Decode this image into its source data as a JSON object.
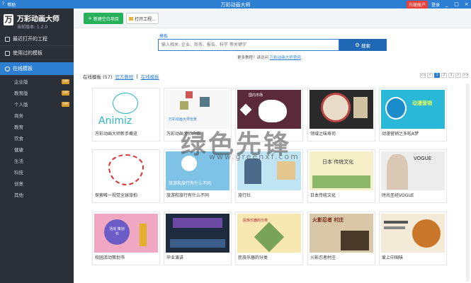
{
  "titlebar": {
    "menu": [
      "?",
      "帮助"
    ],
    "title": "万彩动画大师",
    "upgrade": "升级账户",
    "login": "登录",
    "controls": [
      "_",
      "□",
      "×"
    ]
  },
  "sidebar": {
    "logo_letter": "万",
    "app_name": "万彩动画大师",
    "version": "当前版本: 1.2.0",
    "nav": [
      {
        "label": "最近打开的工程",
        "icon": "folder-icon"
      },
      {
        "label": "使用过的模板",
        "icon": "template-icon"
      },
      {
        "label": "在线模板",
        "icon": "cloud-icon"
      }
    ],
    "categories": [
      {
        "label": "企业版",
        "vip": "VIP"
      },
      {
        "label": "教育版",
        "vip": "VIP"
      },
      {
        "label": "个人版",
        "vip": "VIP"
      },
      {
        "label": "商务"
      },
      {
        "label": "教育"
      },
      {
        "label": "饮食"
      },
      {
        "label": "健康"
      },
      {
        "label": "生活"
      },
      {
        "label": "科技"
      },
      {
        "label": "创意"
      },
      {
        "label": "其他"
      }
    ]
  },
  "toolbar": {
    "new_label": "新建空白项目",
    "open_label": "打开工程..."
  },
  "search": {
    "label": "模板",
    "placeholder": "输入相关: 企业、商务、报告、科学 等关键字",
    "button": "搜索",
    "more_text": "更多教程？请访问",
    "more_link": "万彩动画大师官网"
  },
  "section": {
    "title": "在线模板 (57)",
    "link1": "官方教程",
    "sep": "|",
    "link2": "在线模板"
  },
  "pager": [
    "<<",
    "<",
    "1",
    "2",
    "3",
    ">",
    ">>"
  ],
  "cards": [
    {
      "caption": "万彩动画大师新手概览",
      "thumb_text": "Animiz"
    },
    {
      "caption": "万彩动画大师介绍",
      "thumb_text": "万彩动画大师全景"
    },
    {
      "caption": "",
      "thumb_text": "国内市场"
    },
    {
      "caption": "领域之味寿司",
      "thumb_text": ""
    },
    {
      "caption": "动漫营销之多啦A梦",
      "thumb_text": "动漫营销"
    },
    {
      "caption": "探索唯一视觉全球旅拍",
      "thumb_text": ""
    },
    {
      "caption": "旅游和旅行有什么不同",
      "thumb_text": "旅游和旅行有什么不同"
    },
    {
      "caption": "旅行社",
      "thumb_text": ""
    },
    {
      "caption": "日本传统文化",
      "thumb_text": "日本 传统文化"
    },
    {
      "caption": "时尚圣经VOGUE",
      "thumb_text": "VOGUE"
    },
    {
      "caption": "校园活动策划书",
      "thumb_text": "活动 策划书"
    },
    {
      "caption": "毕业演讲",
      "thumb_text": ""
    },
    {
      "caption": "民族乐器的分类",
      "thumb_text": "民族乐器的分类"
    },
    {
      "caption": "火影忍者村庄",
      "thumb_text": "火影忍者 村庄"
    },
    {
      "caption": "爱上中国味",
      "thumb_text": ""
    }
  ],
  "watermark": {
    "main": "绿色先锋",
    "sub": "www.greenxf.com"
  },
  "colors": {
    "accent": "#2d7fd1",
    "sidebar": "#2b2f38",
    "new_button": "#27b15a",
    "upgrade": "#e8403a"
  }
}
